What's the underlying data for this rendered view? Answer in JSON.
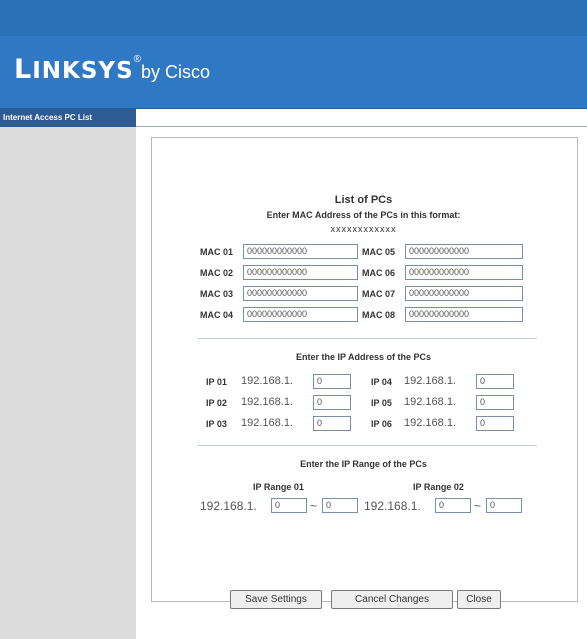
{
  "brand": {
    "wordmark": "LINKSYS",
    "registered": "®",
    "byline": "by Cisco",
    "color": "#2f79c4"
  },
  "sidebar": {
    "heading": "Internet Access PC List"
  },
  "list": {
    "title": "List of PCs",
    "mac_instruction": "Enter MAC Address of the PCs in this format:",
    "mac_format": "xxxxxxxxxxxx",
    "mac_entries": [
      {
        "label": "MAC 01",
        "value": "000000000000"
      },
      {
        "label": "MAC 02",
        "value": "000000000000"
      },
      {
        "label": "MAC 03",
        "value": "000000000000"
      },
      {
        "label": "MAC 04",
        "value": "000000000000"
      },
      {
        "label": "MAC 05",
        "value": "000000000000"
      },
      {
        "label": "MAC 06",
        "value": "000000000000"
      },
      {
        "label": "MAC 07",
        "value": "000000000000"
      },
      {
        "label": "MAC 08",
        "value": "000000000000"
      }
    ],
    "ip_instruction": "Enter the IP Address of the PCs",
    "ip_prefix": "192.168.1.",
    "ip_entries": [
      {
        "label": "IP 01",
        "value": "0"
      },
      {
        "label": "IP 02",
        "value": "0"
      },
      {
        "label": "IP 03",
        "value": "0"
      },
      {
        "label": "IP 04",
        "value": "0"
      },
      {
        "label": "IP 05",
        "value": "0"
      },
      {
        "label": "IP 06",
        "value": "0"
      }
    ],
    "range_instruction": "Enter the IP Range of the PCs",
    "range_separator": "~",
    "ranges": [
      {
        "label": "IP Range 01",
        "prefix": "192.168.1.",
        "start": "0",
        "end": "0"
      },
      {
        "label": "IP Range 02",
        "prefix": "192.168.1.",
        "start": "0",
        "end": "0"
      }
    ]
  },
  "buttons": {
    "save": "Save Settings",
    "cancel": "Cancel Changes",
    "close": "Close"
  }
}
